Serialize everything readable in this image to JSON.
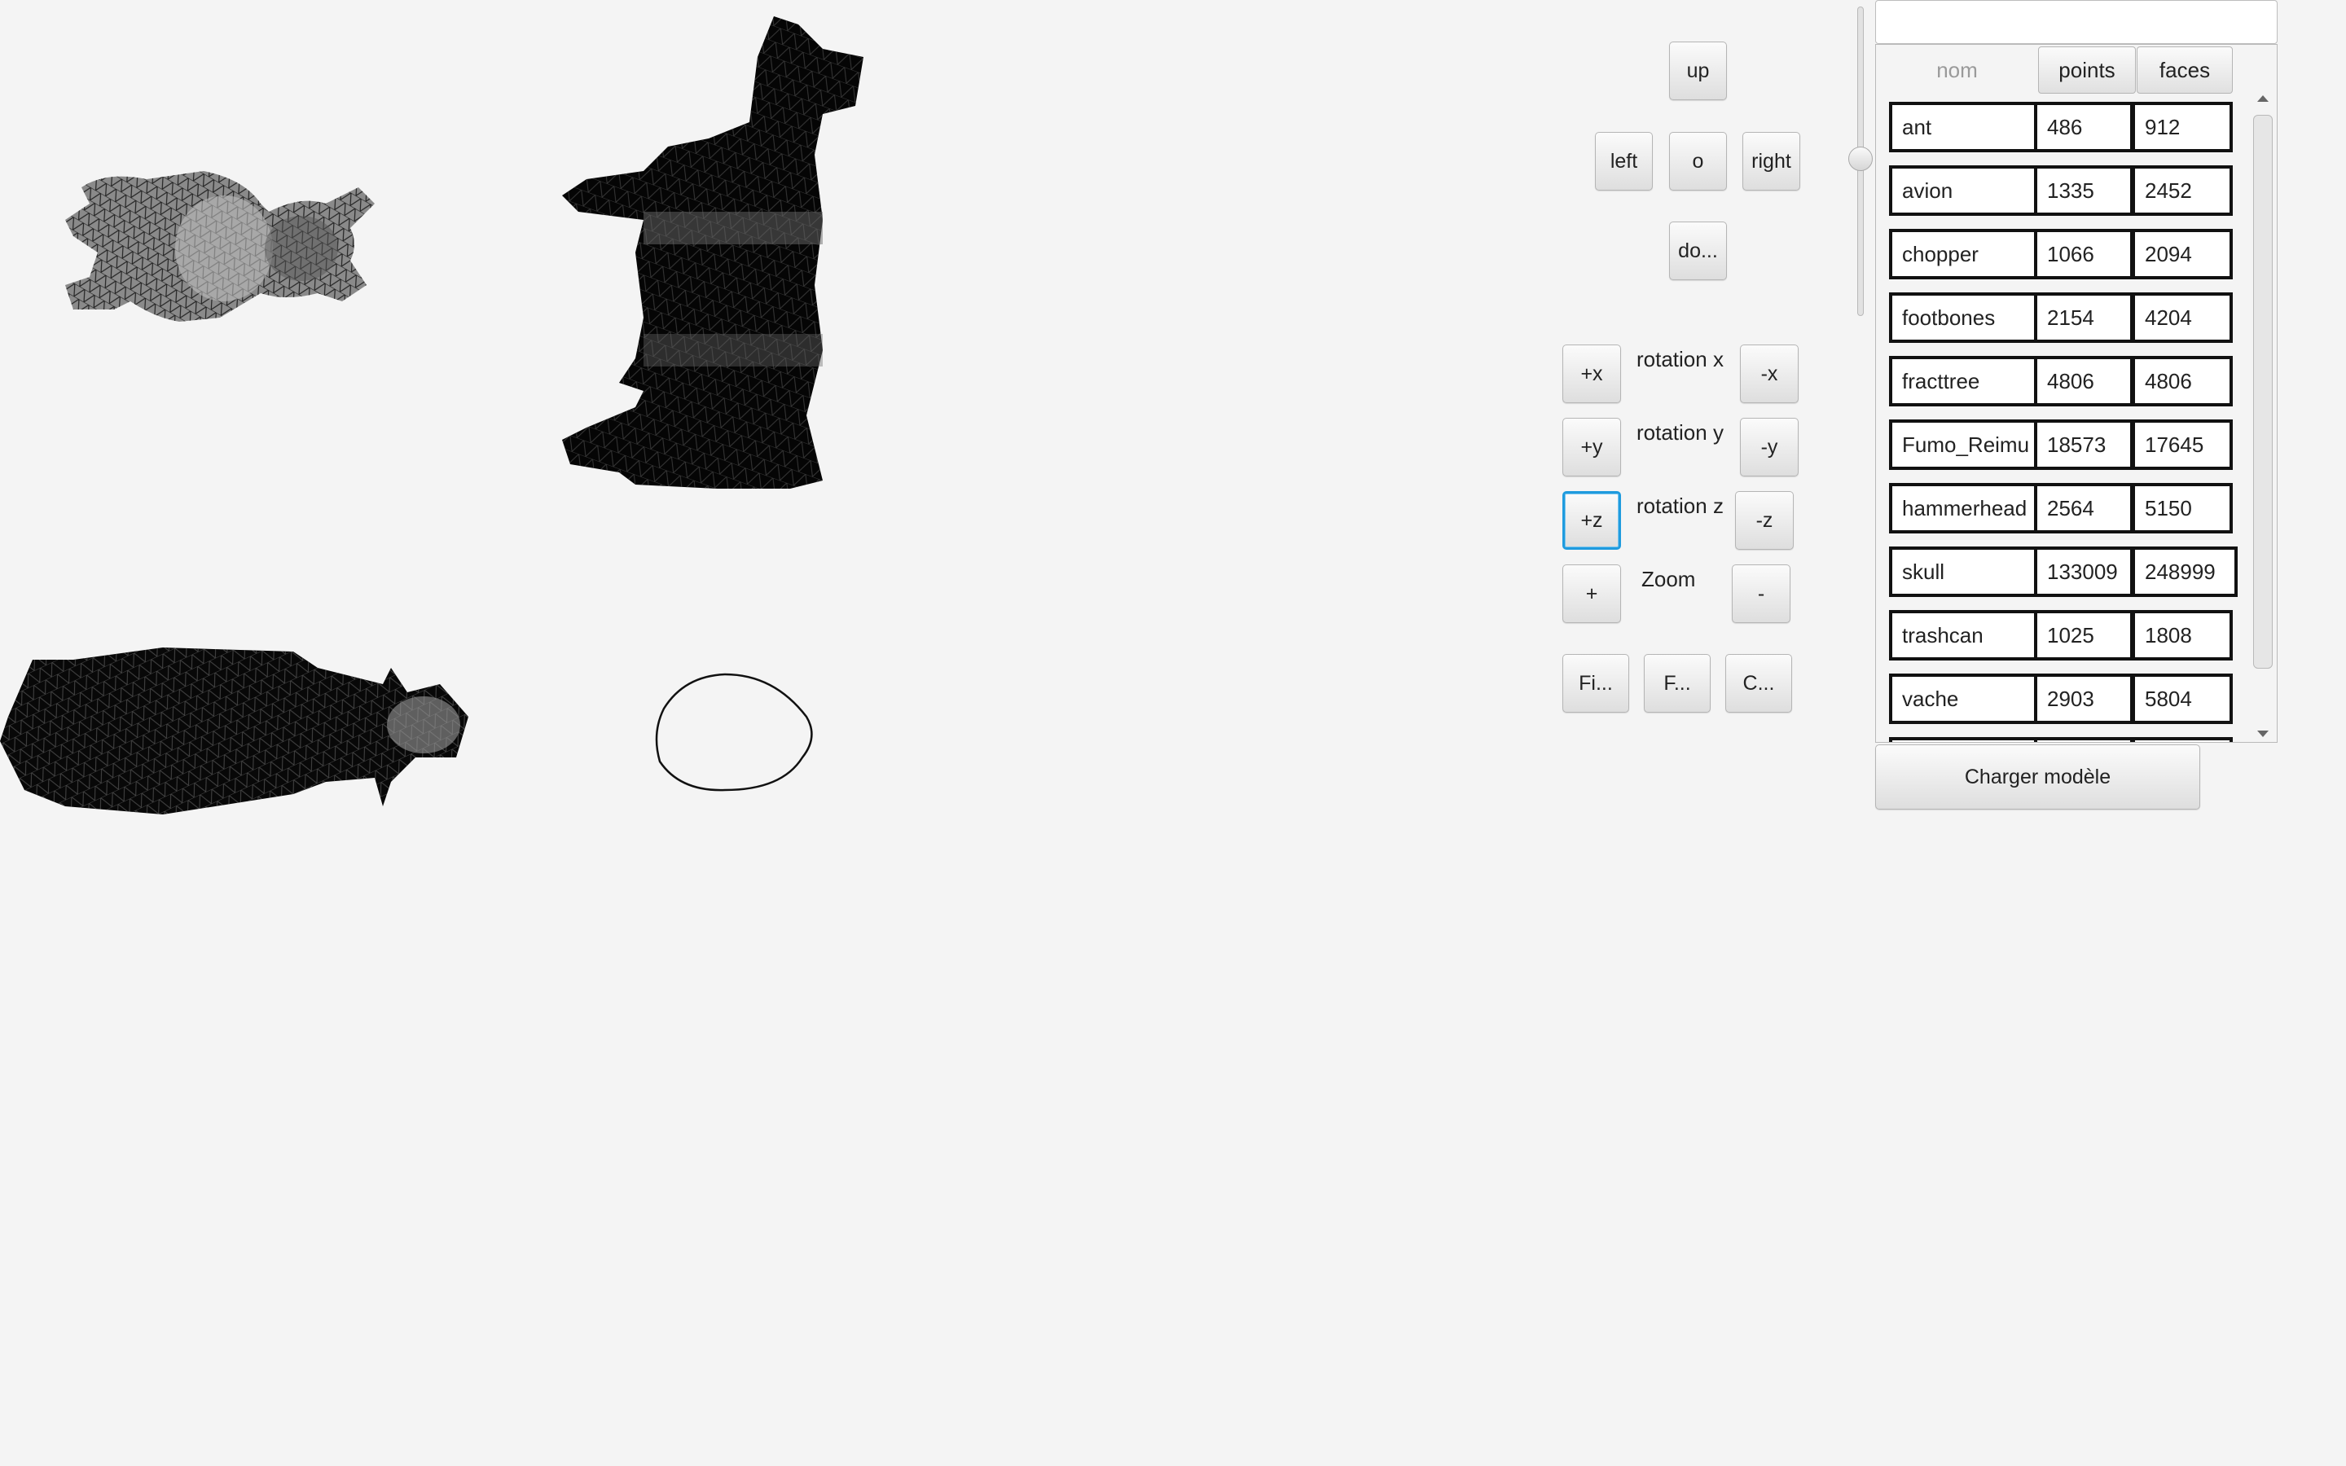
{
  "controls": {
    "up": "up",
    "left": "left",
    "center": "o",
    "right": "right",
    "down": "do...",
    "plus_x": "+x",
    "rotation_x": "rotation x",
    "minus_x": "-x",
    "plus_y": "+y",
    "rotation_y": "rotation y",
    "minus_y": "-y",
    "plus_z": "+z",
    "rotation_z": "rotation z",
    "minus_z": "-z",
    "zoom_in": "+",
    "zoom_label": "Zoom",
    "zoom_out": "-",
    "btn_fi": "Fi...",
    "btn_f": "F...",
    "btn_c": "C..."
  },
  "search": {
    "value": ""
  },
  "slider": {
    "value": 0.5
  },
  "table": {
    "headers": {
      "nom": "nom",
      "points": "points",
      "faces": "faces"
    },
    "rows": [
      {
        "nom": "ant",
        "points": "486",
        "faces": "912"
      },
      {
        "nom": "avion",
        "points": "1335",
        "faces": "2452"
      },
      {
        "nom": "chopper",
        "points": "1066",
        "faces": "2094"
      },
      {
        "nom": "footbones",
        "points": "2154",
        "faces": "4204"
      },
      {
        "nom": "fracttree",
        "points": "4806",
        "faces": "4806"
      },
      {
        "nom": "Fumo_Reimu",
        "points": "18573",
        "faces": "17645"
      },
      {
        "nom": "hammerhead",
        "points": "2564",
        "faces": "5150"
      },
      {
        "nom": "skull",
        "points": "133009",
        "faces": "248999"
      },
      {
        "nom": "trashcan",
        "points": "1025",
        "faces": "1808"
      },
      {
        "nom": "vache",
        "points": "2903",
        "faces": "5804"
      }
    ]
  },
  "load_button": "Charger modèle"
}
